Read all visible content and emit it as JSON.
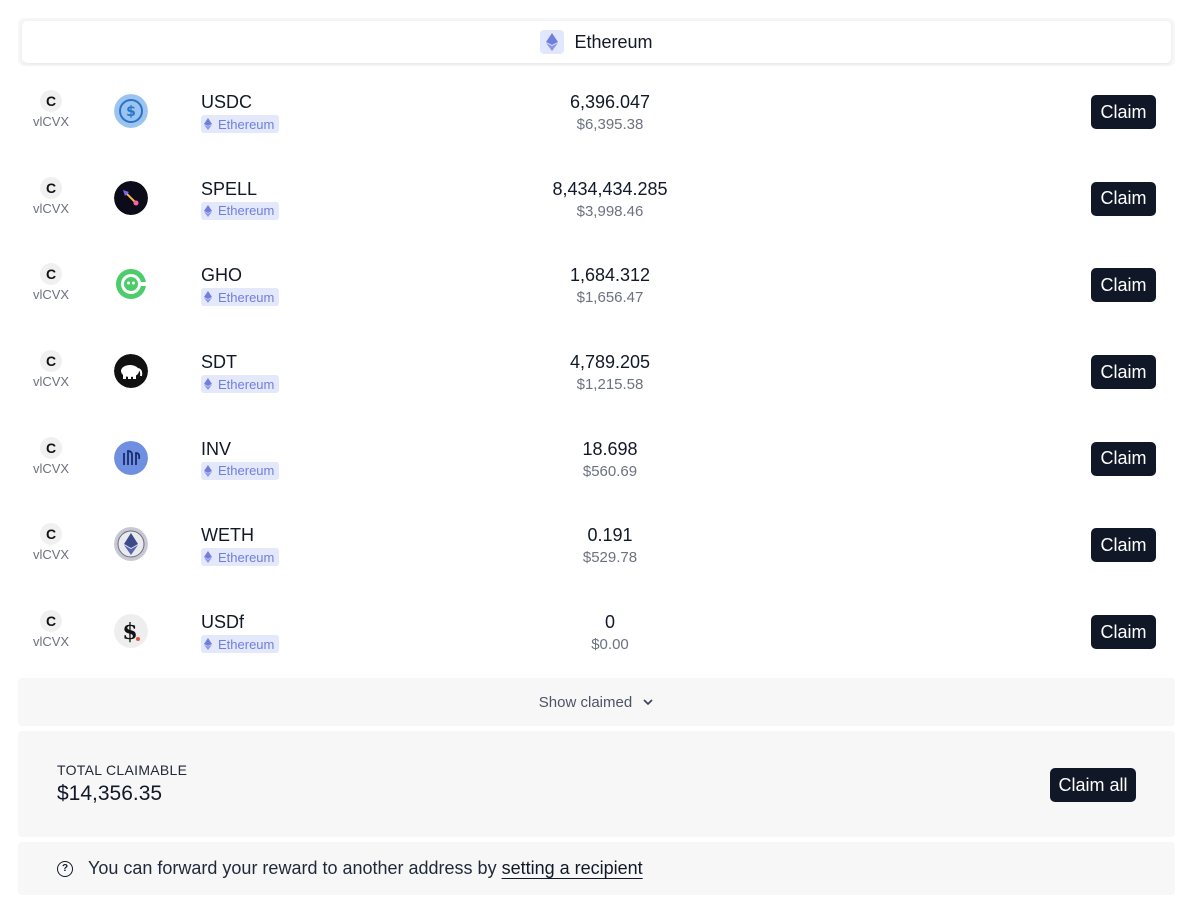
{
  "network": {
    "name": "Ethereum",
    "icon": "ethereum-icon"
  },
  "rows": [
    {
      "source": "vlCVX",
      "token": "USDC",
      "token_icon": "usdc-icon",
      "chain": "Ethereum",
      "amount": "6,396.047",
      "usd": "$6,395.38",
      "claim_label": "Claim"
    },
    {
      "source": "vlCVX",
      "token": "SPELL",
      "token_icon": "spell-icon",
      "chain": "Ethereum",
      "amount": "8,434,434.285",
      "usd": "$3,998.46",
      "claim_label": "Claim"
    },
    {
      "source": "vlCVX",
      "token": "GHO",
      "token_icon": "gho-icon",
      "chain": "Ethereum",
      "amount": "1,684.312",
      "usd": "$1,656.47",
      "claim_label": "Claim"
    },
    {
      "source": "vlCVX",
      "token": "SDT",
      "token_icon": "sdt-icon",
      "chain": "Ethereum",
      "amount": "4,789.205",
      "usd": "$1,215.58",
      "claim_label": "Claim"
    },
    {
      "source": "vlCVX",
      "token": "INV",
      "token_icon": "inv-icon",
      "chain": "Ethereum",
      "amount": "18.698",
      "usd": "$560.69",
      "claim_label": "Claim"
    },
    {
      "source": "vlCVX",
      "token": "WETH",
      "token_icon": "weth-icon",
      "chain": "Ethereum",
      "amount": "0.191",
      "usd": "$529.78",
      "claim_label": "Claim"
    },
    {
      "source": "vlCVX",
      "token": "USDf",
      "token_icon": "usdf-icon",
      "chain": "Ethereum",
      "amount": "0",
      "usd": "$0.00",
      "claim_label": "Claim"
    }
  ],
  "show_claimed": {
    "label": "Show claimed",
    "icon": "chevron-down-icon"
  },
  "total": {
    "label": "TOTAL CLAIMABLE",
    "value": "$14,356.35",
    "claim_all_label": "Claim all"
  },
  "info": {
    "icon": "question-circle-icon",
    "text": "You can forward your reward to another address by",
    "link_label": "setting a recipient"
  },
  "colors": {
    "button_bg": "#101828",
    "chain_badge_bg": "#e3e8fb",
    "chain_badge_text": "#6f7fdc",
    "panel_bg": "#f7f7f8"
  }
}
